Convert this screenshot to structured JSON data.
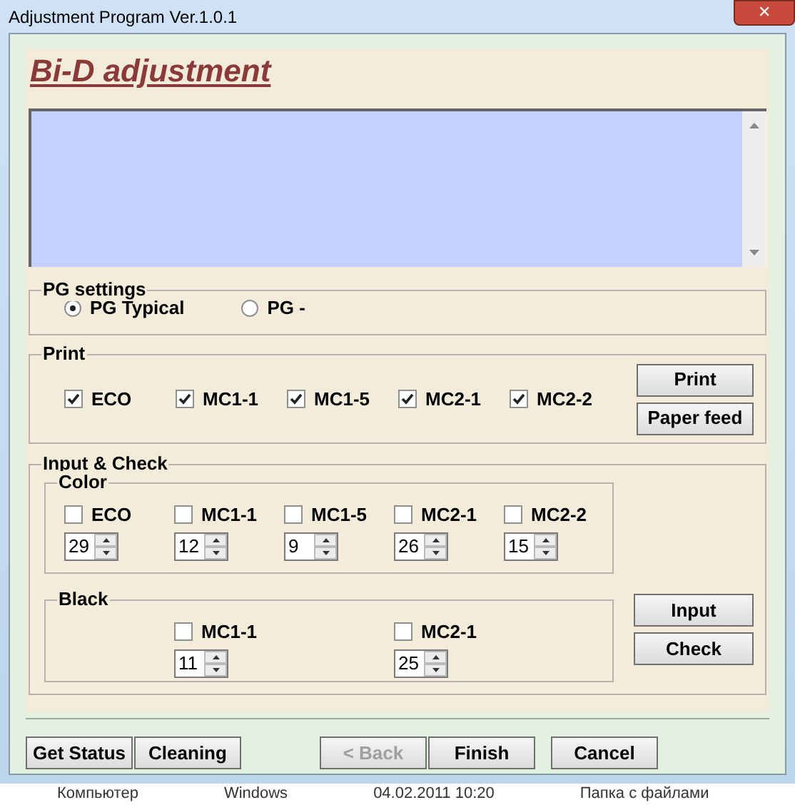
{
  "window": {
    "title": "Adjustment Program Ver.1.0.1",
    "close": "✕"
  },
  "heading": "Bi-D adjustment",
  "pg_settings": {
    "label": "PG settings",
    "options": [
      {
        "label": "PG Typical",
        "selected": true
      },
      {
        "label": "PG -",
        "selected": false
      }
    ]
  },
  "print": {
    "label": "Print",
    "items": [
      {
        "label": "ECO",
        "checked": true
      },
      {
        "label": "MC1-1",
        "checked": true
      },
      {
        "label": "MC1-5",
        "checked": true
      },
      {
        "label": "MC2-1",
        "checked": true
      },
      {
        "label": "MC2-2",
        "checked": true
      }
    ],
    "buttons": [
      "Print",
      "Paper feed"
    ]
  },
  "input_check": {
    "label": "Input & Check",
    "color": {
      "label": "Color",
      "items": [
        {
          "label": "ECO",
          "checked": false,
          "value": "29"
        },
        {
          "label": "MC1-1",
          "checked": false,
          "value": "12"
        },
        {
          "label": "MC1-5",
          "checked": false,
          "value": "9"
        },
        {
          "label": "MC2-1",
          "checked": false,
          "value": "26"
        },
        {
          "label": "MC2-2",
          "checked": false,
          "value": "15"
        }
      ]
    },
    "black": {
      "label": "Black",
      "items": [
        {
          "label": "MC1-1",
          "checked": false,
          "value": "11"
        },
        {
          "label": "MC2-1",
          "checked": false,
          "value": "25"
        }
      ]
    },
    "buttons": [
      "Input",
      "Check"
    ]
  },
  "footer_buttons": [
    {
      "label": "Get Status",
      "disabled": false
    },
    {
      "label": "Cleaning",
      "disabled": false
    },
    {
      "label": "< Back",
      "disabled": true
    },
    {
      "label": "Finish",
      "disabled": false
    },
    {
      "label": "Cancel",
      "disabled": false
    }
  ],
  "background_window": {
    "items": [
      "Компьютер",
      "Windows",
      "04.02.2011 10:20",
      "Папка с файлами"
    ]
  }
}
